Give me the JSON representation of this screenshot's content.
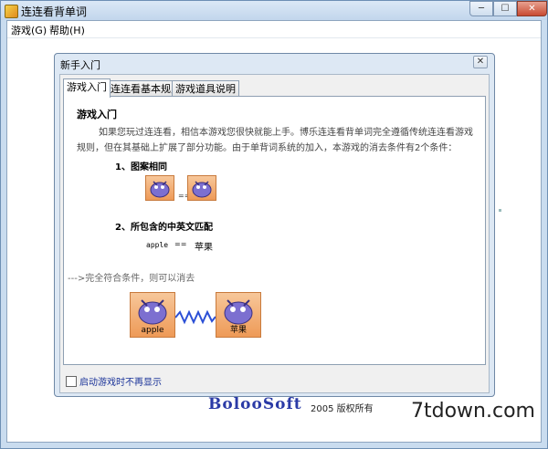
{
  "window": {
    "title": "连连看背单词",
    "min_glyph": "─",
    "max_glyph": "☐",
    "close_glyph": "✕"
  },
  "menu": {
    "items": [
      "游戏(G)",
      "帮助(H)"
    ]
  },
  "footer": {
    "brand": "BolooSoft",
    "copyright": "2005 版权所有",
    "watermark": "7tdown.com"
  },
  "dialog": {
    "title": "新手入门",
    "close_glyph": "✕",
    "tabs": [
      "游戏入门",
      "连连看基本规则",
      "游戏道具说明"
    ],
    "active_tab": 0,
    "content": {
      "heading": "游戏入门",
      "paragraph": "如果您玩过连连看，相信本游戏您很快就能上手。博乐连连看背单词完全遵循传统连连看游戏规则，但在其基础上扩展了部分功能。由于单背词系统的加入，本游戏的消去条件有2个条件：",
      "rule1": "1、图案相同",
      "rule1_eq": "==",
      "rule2": "2、所包含的中英文匹配",
      "example_en": "apple",
      "example_eq": "==",
      "example_zh": "苹果",
      "condition": "--->完全符合条件，则可以消去",
      "tile_left_label": "apple",
      "tile_right_label": "苹果"
    },
    "checkbox_label": "启动游戏时不再显示",
    "checkbox_checked": false
  }
}
